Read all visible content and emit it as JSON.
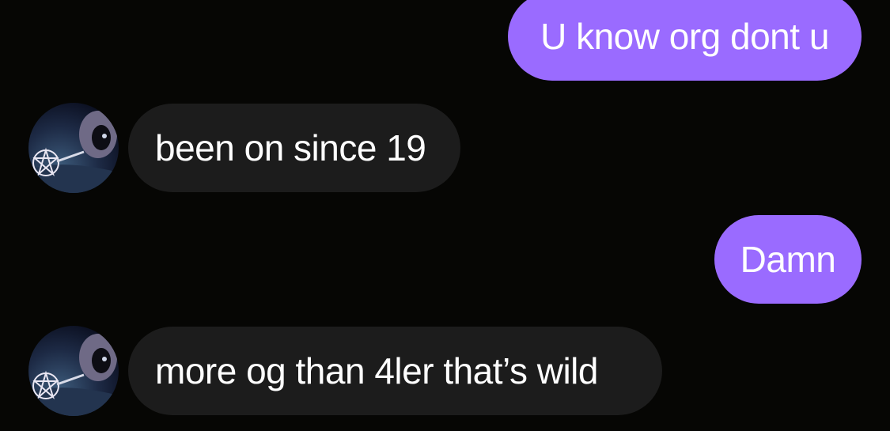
{
  "messages": [
    {
      "direction": "outgoing",
      "text": "U know org dont u"
    },
    {
      "direction": "incoming",
      "text": "been on since 19",
      "avatar": "contact-avatar"
    },
    {
      "direction": "outgoing",
      "text": "Damn"
    },
    {
      "direction": "incoming",
      "text": "more og than 4ler that’s wild",
      "avatar": "contact-avatar"
    }
  ],
  "colors": {
    "background": "#060604",
    "outgoing_bubble": "#9a6bff",
    "incoming_bubble": "#1c1c1c",
    "text": "#ffffff"
  }
}
